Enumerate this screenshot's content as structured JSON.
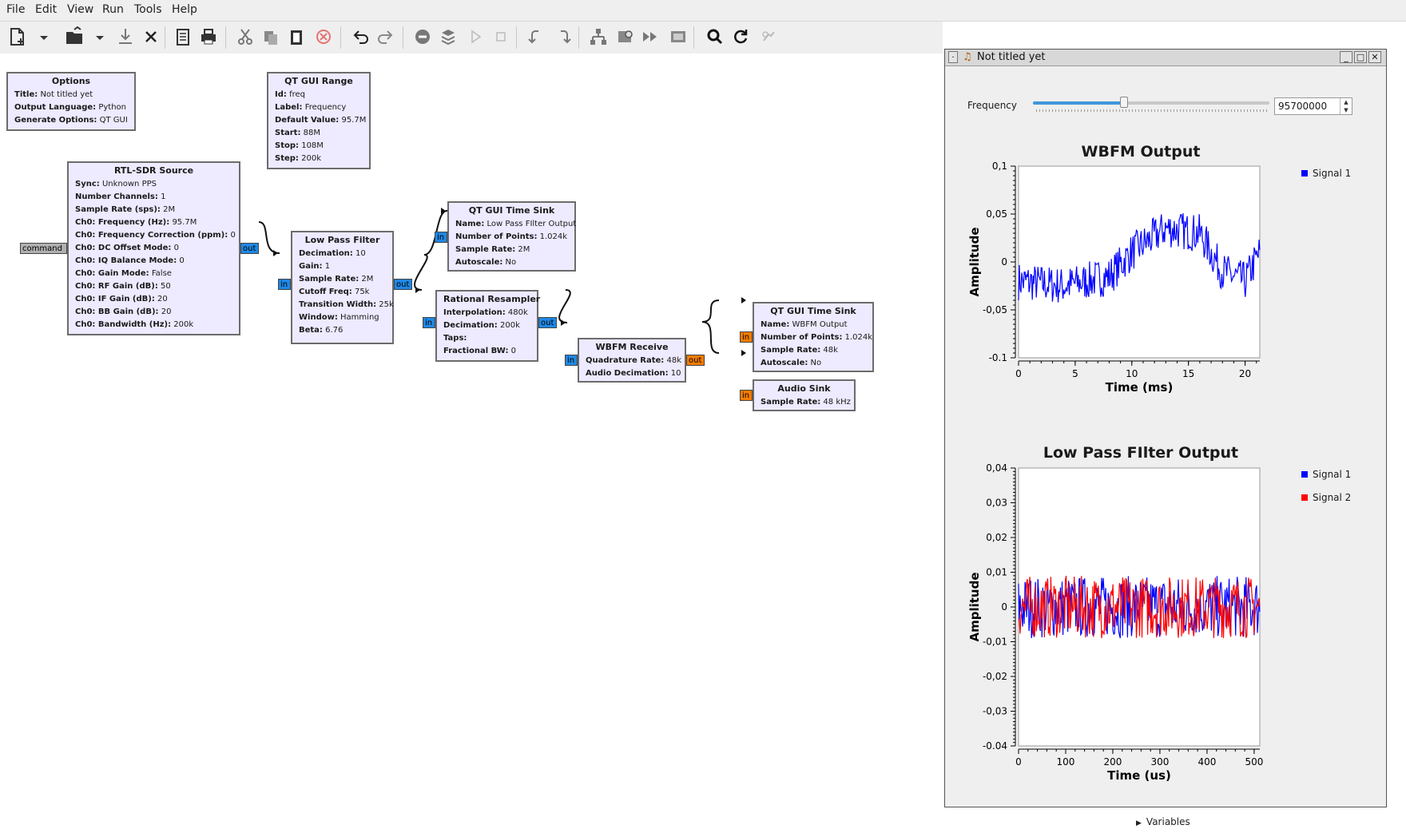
{
  "menu": [
    "File",
    "Edit",
    "View",
    "Run",
    "Tools",
    "Help"
  ],
  "toolbar": {
    "icons": [
      "new-icon",
      "new-dropdown-icon",
      "open-icon",
      "open-dropdown-icon",
      "save-icon",
      "close-icon",
      "document-icon",
      "print-icon",
      "cut-icon",
      "copy-icon",
      "paste-icon",
      "delete-icon",
      "undo-icon",
      "redo-icon",
      "disable-icon",
      "bypass-icon",
      "execute-icon",
      "stop-icon",
      "rotate-left-icon",
      "rotate-right-icon",
      "hierarchy-icon",
      "find-block-icon",
      "generate-icon",
      "fullscreen-icon",
      "search-icon",
      "reload-icon",
      "debug-icon"
    ]
  },
  "canvas": {
    "options": {
      "title": "Options",
      "rows": [
        [
          "Title:",
          "Not titled yet"
        ],
        [
          "Output Language:",
          "Python"
        ],
        [
          "Generate Options:",
          "QT GUI"
        ]
      ]
    },
    "qt_gui_range": {
      "title": "QT GUI Range",
      "rows": [
        [
          "Id:",
          "freq"
        ],
        [
          "Label:",
          "Frequency"
        ],
        [
          "Default Value:",
          "95.7M"
        ],
        [
          "Start:",
          "88M"
        ],
        [
          "Stop:",
          "108M"
        ],
        [
          "Step:",
          "200k"
        ]
      ]
    },
    "rtl_sdr": {
      "title": "RTL-SDR Source",
      "rows": [
        [
          "Sync:",
          "Unknown PPS"
        ],
        [
          "Number Channels:",
          "1"
        ],
        [
          "Sample Rate (sps):",
          "2M"
        ],
        [
          "Ch0: Frequency (Hz):",
          "95.7M"
        ],
        [
          "Ch0: Frequency Correction (ppm):",
          "0"
        ],
        [
          "Ch0: DC Offset Mode:",
          "0"
        ],
        [
          "Ch0: IQ Balance Mode:",
          "0"
        ],
        [
          "Ch0: Gain Mode:",
          "False"
        ],
        [
          "Ch0: RF Gain (dB):",
          "50"
        ],
        [
          "Ch0: IF Gain (dB):",
          "20"
        ],
        [
          "Ch0: BB Gain (dB):",
          "20"
        ],
        [
          "Ch0: Bandwidth (Hz):",
          "200k"
        ]
      ]
    },
    "low_pass": {
      "title": "Low Pass Filter",
      "rows": [
        [
          "Decimation:",
          "10"
        ],
        [
          "Gain:",
          "1"
        ],
        [
          "Sample Rate:",
          "2M"
        ],
        [
          "Cutoff Freq:",
          "75k"
        ],
        [
          "Transition Width:",
          "25k"
        ],
        [
          "Window:",
          "Hamming"
        ],
        [
          "Beta:",
          "6.76"
        ]
      ]
    },
    "time_sink_1": {
      "title": "QT GUI Time Sink",
      "rows": [
        [
          "Name:",
          "Low Pass FIlter Output"
        ],
        [
          "Number of Points:",
          "1.024k"
        ],
        [
          "Sample Rate:",
          "2M"
        ],
        [
          "Autoscale:",
          "No"
        ]
      ]
    },
    "resampler": {
      "title": "Rational Resampler",
      "rows": [
        [
          "Interpolation:",
          "480k"
        ],
        [
          "Decimation:",
          "200k"
        ],
        [
          "Taps:",
          ""
        ],
        [
          "Fractional BW:",
          "0"
        ]
      ]
    },
    "wbfm": {
      "title": "WBFM Receive",
      "rows": [
        [
          "Quadrature Rate:",
          "48k"
        ],
        [
          "Audio Decimation:",
          "10"
        ]
      ]
    },
    "time_sink_2": {
      "title": "QT GUI Time Sink",
      "rows": [
        [
          "Name:",
          "WBFM Output"
        ],
        [
          "Number of Points:",
          "1.024k"
        ],
        [
          "Sample Rate:",
          "48k"
        ],
        [
          "Autoscale:",
          "No"
        ]
      ]
    },
    "audio_sink": {
      "title": "Audio Sink",
      "rows": [
        [
          "Sample Rate:",
          "48 kHz"
        ]
      ]
    },
    "ports": {
      "command": "command",
      "out": "out",
      "in": "in"
    }
  },
  "qt_window": {
    "title": "Not titled yet",
    "frequency_label": "Frequency",
    "frequency_value": "95700000",
    "frequency_fraction": 0.385
  },
  "chart_data": [
    {
      "type": "line",
      "title": "WBFM Output",
      "xlabel": "Time (ms)",
      "ylabel": "Amplitude",
      "xlim": [
        0,
        21.3
      ],
      "ylim": [
        -0.1,
        0.1
      ],
      "xticks": [
        "0",
        "5",
        "10",
        "15",
        "20"
      ],
      "yticks": [
        "0,1",
        "0,05",
        "0",
        "-0,05",
        "-0.1"
      ],
      "legend": "top-right",
      "series": [
        {
          "name": "Signal 1",
          "color": "#0000ff",
          "envelope_center": [
            [
              0,
              -0.02
            ],
            [
              4,
              -0.025
            ],
            [
              8,
              -0.015
            ],
            [
              10,
              0.01
            ],
            [
              13,
              0.035
            ],
            [
              16,
              0.03
            ],
            [
              18,
              -0.01
            ],
            [
              20,
              -0.02
            ],
            [
              21.3,
              0.01
            ]
          ],
          "noise": 0.02
        }
      ]
    },
    {
      "type": "line",
      "title": "Low Pass FIlter Output",
      "xlabel": "Time (us)",
      "ylabel": "Amplitude",
      "xlim": [
        0,
        512
      ],
      "ylim": [
        -0.04,
        0.04
      ],
      "xticks": [
        "0",
        "100",
        "200",
        "300",
        "400",
        "500"
      ],
      "yticks": [
        "0,04",
        "0,03",
        "0,02",
        "0,01",
        "0",
        "-0,01",
        "-0,02",
        "-0,03",
        "-0.04"
      ],
      "legend": "top-right",
      "series": [
        {
          "name": "Signal 1",
          "color": "#0000ff",
          "noise": 0.009
        },
        {
          "name": "Signal 2",
          "color": "#ff0000",
          "noise": 0.009
        }
      ]
    }
  ],
  "bottom": {
    "variables_label": "Variables"
  }
}
